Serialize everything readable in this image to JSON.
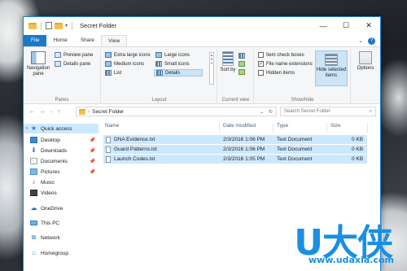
{
  "window": {
    "title": "Secret Folder",
    "controls": {
      "minimize": "—",
      "maximize": "☐",
      "close": "✕"
    }
  },
  "ribbon_tabs": [
    {
      "label": "File"
    },
    {
      "label": "Home"
    },
    {
      "label": "Share"
    },
    {
      "label": "View"
    }
  ],
  "ribbon": {
    "panes": {
      "navigation_pane": "Navigation pane",
      "preview_pane": "Preview pane",
      "details_pane": "Details pane",
      "label": "Panes"
    },
    "layout": {
      "extra_large_icons": "Extra large icons",
      "large_icons": "Large icons",
      "medium_icons": "Medium icons",
      "small_icons": "Small icons",
      "list": "List",
      "details": "Details",
      "label": "Layout"
    },
    "current_view": {
      "sort_by": "Sort by",
      "label": "Current view"
    },
    "show_hide": {
      "item_check_boxes": "Item check boxes",
      "file_name_extensions": "File name extensions",
      "hidden_items": "Hidden items",
      "hide_selected_items": "Hide selected items",
      "label": "Show/hide"
    },
    "options": {
      "label": "Options"
    }
  },
  "address": {
    "breadcrumb": "Secret Folder",
    "search_placeholder": "Search Secret Folder"
  },
  "nav_pane": {
    "items": [
      {
        "label": "Quick access"
      },
      {
        "label": "Desktop"
      },
      {
        "label": "Downloads"
      },
      {
        "label": "Documents"
      },
      {
        "label": "Pictures"
      },
      {
        "label": "Music"
      },
      {
        "label": "Videos"
      },
      {
        "label": "OneDrive"
      },
      {
        "label": "This PC"
      },
      {
        "label": "Network"
      },
      {
        "label": "Homegroup"
      }
    ]
  },
  "file_list": {
    "columns": [
      "Name",
      "Date modified",
      "Type",
      "Size"
    ],
    "rows": [
      {
        "name": "DNA Evidence.txt",
        "date": "2/3/2016 1:06 PM",
        "type": "Text Document",
        "size": "0 KB"
      },
      {
        "name": "Guard Patterns.txt",
        "date": "2/3/2016 1:06 PM",
        "type": "Text Document",
        "size": "0 KB"
      },
      {
        "name": "Launch Codes.txt",
        "date": "2/3/2016 1:05 PM",
        "type": "Text Document",
        "size": "0 KB"
      }
    ]
  },
  "watermark": {
    "text": "U大侠",
    "url": "www.udaxia.com"
  },
  "colors": {
    "accent": "#1979ca",
    "selection": "#cce8ff",
    "watermark": "#1a8fe3"
  }
}
